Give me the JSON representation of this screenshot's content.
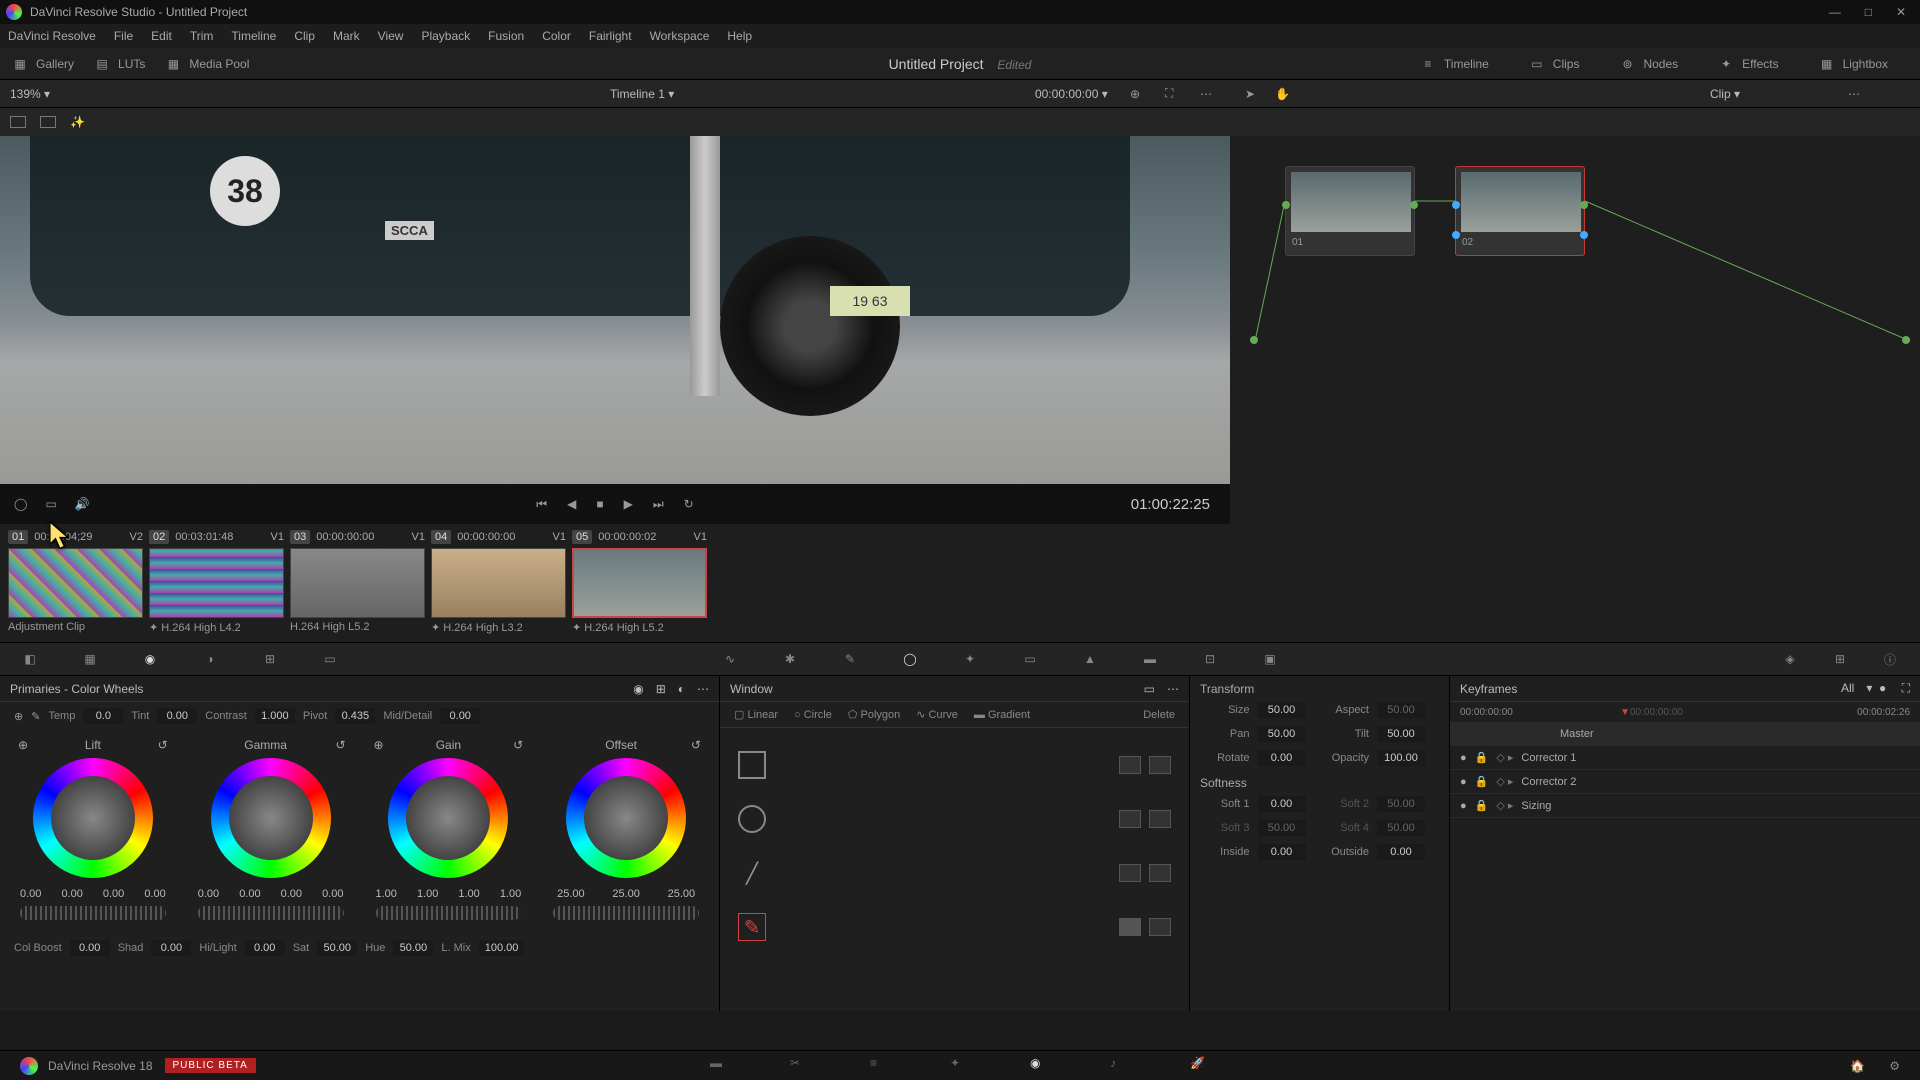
{
  "titlebar": {
    "text": "DaVinci Resolve Studio - Untitled Project"
  },
  "menu": [
    "DaVinci Resolve",
    "File",
    "Edit",
    "Trim",
    "Timeline",
    "Clip",
    "Mark",
    "View",
    "Playback",
    "Fusion",
    "Color",
    "Fairlight",
    "Workspace",
    "Help"
  ],
  "toolbar": {
    "gallery": "Gallery",
    "luts": "LUTs",
    "mediapool": "Media Pool",
    "project": "Untitled Project",
    "edited": "Edited",
    "timeline": "Timeline",
    "clips": "Clips",
    "nodes": "Nodes",
    "effects": "Effects",
    "lightbox": "Lightbox"
  },
  "subbar": {
    "zoom": "139%",
    "timeline": "Timeline 1",
    "tc": "00:00:00:00",
    "clip": "Clip"
  },
  "viewer": {
    "carnum": "38",
    "plate": "19  63",
    "scca": "SCCA",
    "tc": "01:00:22:25"
  },
  "nodes": [
    {
      "id": "01"
    },
    {
      "id": "02"
    }
  ],
  "clips": [
    {
      "num": "01",
      "tc": "00:00:04;29",
      "trk": "V2",
      "name": "Adjustment Clip"
    },
    {
      "num": "02",
      "tc": "00:03:01:48",
      "trk": "V1",
      "name": "H.264 High L4.2"
    },
    {
      "num": "03",
      "tc": "00:00:00:00",
      "trk": "V1",
      "name": "H.264 High L5.2"
    },
    {
      "num": "04",
      "tc": "00:00:00:00",
      "trk": "V1",
      "name": "H.264 High L3.2"
    },
    {
      "num": "05",
      "tc": "00:00:00:02",
      "trk": "V1",
      "name": "H.264 High L5.2"
    }
  ],
  "primaries": {
    "title": "Primaries - Color Wheels",
    "adj1": {
      "temp": "Temp",
      "temp_v": "0.0",
      "tint": "Tint",
      "tint_v": "0.00",
      "contrast": "Contrast",
      "contrast_v": "1.000",
      "pivot": "Pivot",
      "pivot_v": "0.435",
      "md": "Mid/Detail",
      "md_v": "0.00"
    },
    "wheels": [
      {
        "name": "Lift",
        "v": [
          "0.00",
          "0.00",
          "0.00",
          "0.00"
        ]
      },
      {
        "name": "Gamma",
        "v": [
          "0.00",
          "0.00",
          "0.00",
          "0.00"
        ]
      },
      {
        "name": "Gain",
        "v": [
          "1.00",
          "1.00",
          "1.00",
          "1.00"
        ]
      },
      {
        "name": "Offset",
        "v": [
          "25.00",
          "25.00",
          "25.00"
        ]
      }
    ],
    "adj2": {
      "cb": "Col Boost",
      "cb_v": "0.00",
      "shad": "Shad",
      "shad_v": "0.00",
      "hl": "Hi/Light",
      "hl_v": "0.00",
      "sat": "Sat",
      "sat_v": "50.00",
      "hue": "Hue",
      "hue_v": "50.00",
      "lmix": "L. Mix",
      "lmix_v": "100.00"
    }
  },
  "window": {
    "title": "Window",
    "tabs": [
      "Linear",
      "Circle",
      "Polygon",
      "Curve",
      "Gradient",
      "Delete"
    ]
  },
  "transform": {
    "title": "Transform",
    "size": "Size",
    "size_v": "50.00",
    "aspect": "Aspect",
    "aspect_v": "50.00",
    "pan": "Pan",
    "pan_v": "50.00",
    "tilt": "Tilt",
    "tilt_v": "50.00",
    "rotate": "Rotate",
    "rotate_v": "0.00",
    "opacity": "Opacity",
    "opacity_v": "100.00",
    "softness": "Softness",
    "s1": "Soft 1",
    "s1_v": "0.00",
    "s2": "Soft 2",
    "s2_v": "50.00",
    "s3": "Soft 3",
    "s3_v": "50.00",
    "s4": "Soft 4",
    "s4_v": "50.00",
    "inside": "Inside",
    "inside_v": "0.00",
    "outside": "Outside",
    "outside_v": "0.00"
  },
  "keyframes": {
    "title": "Keyframes",
    "all": "All",
    "tc_start": "00:00:00:00",
    "tc_end": "00:00:02:26",
    "master": "Master",
    "items": [
      "Corrector 1",
      "Corrector 2",
      "Sizing"
    ]
  },
  "bottom": {
    "app": "DaVinci Resolve 18",
    "beta": "PUBLIC BETA"
  }
}
